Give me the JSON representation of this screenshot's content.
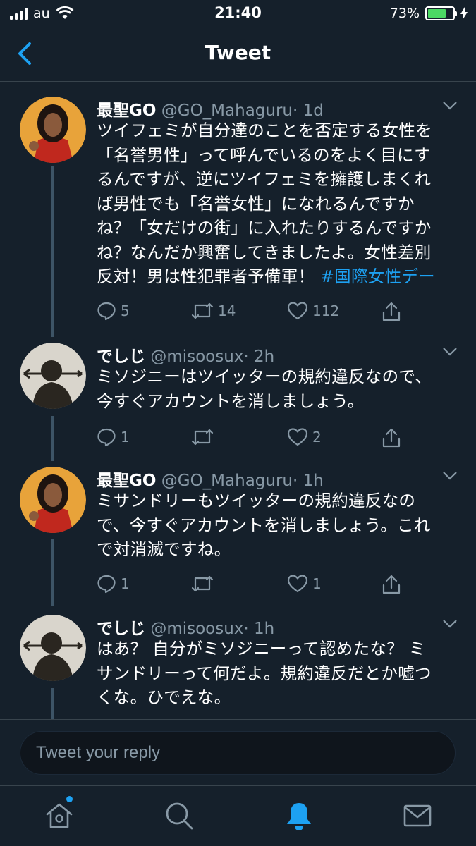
{
  "status_bar": {
    "carrier": "au",
    "time": "21:40",
    "battery": "73%",
    "battery_level": 0.73
  },
  "nav": {
    "title": "Tweet"
  },
  "tweets": [
    {
      "name": "最聖GO",
      "handle": "@GO_Mahaguru",
      "time": "· 1d",
      "lines": [
        "ツイフェミが自分達のことを否定する女性を",
        "「名誉男性」って呼んでいるのをよく目にす",
        "るんですが、逆にツイフェミを擁護しまくれ",
        "ば男性でも「名誉女性」になれるんですか",
        "ね？「女だけの街」に入れたりするんですか",
        "ね？なんだか興奮してきましたよ。女性差別",
        "反対！男は性犯罪者予備軍！"
      ],
      "hashtag": "#国際女性デー",
      "replies": "5",
      "retweets": "14",
      "likes": "112"
    },
    {
      "name": "でしじ",
      "handle": "@misoosux",
      "time": "· 2h",
      "lines": [
        "ミソジニーはツイッターの規約違反なので、",
        "今すぐアカウントを消しましょう。"
      ],
      "replies": "1",
      "retweets": "",
      "likes": "2"
    },
    {
      "name": "最聖GO",
      "handle": "@GO_Mahaguru",
      "time": "· 1h",
      "lines": [
        "ミサンドリーもツイッターの規約違反なの",
        "で、今すぐアカウントを消しましょう。これ",
        "で対消滅ですね。"
      ],
      "replies": "1",
      "retweets": "",
      "likes": "1"
    },
    {
      "name": "でしじ",
      "handle": "@misoosux",
      "time": "· 1h",
      "lines": [
        "はあ？ 自分がミソジニーって認めたな？ ミ",
        "サンドリーって何だよ。規約違反だとか嘘つ",
        "くな。ひでえな。"
      ]
    }
  ],
  "reply_box": {
    "placeholder": "Tweet your reply"
  },
  "tabs": [
    "home-icon",
    "search-icon",
    "notifications-icon",
    "messages-icon"
  ],
  "colors": {
    "background": "#15202b",
    "accent": "#1da1f2",
    "muted": "#8899a6"
  }
}
